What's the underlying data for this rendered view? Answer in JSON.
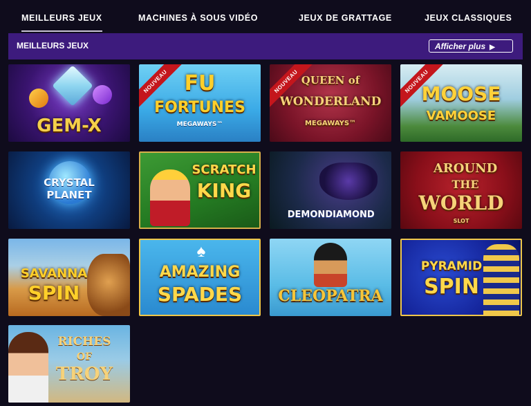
{
  "tabs": [
    {
      "label": "MEILLEURS JEUX",
      "active": true
    },
    {
      "label": "MACHINES À SOUS VIDÉO",
      "active": false
    },
    {
      "label": "JEUX DE GRATTAGE",
      "active": false
    },
    {
      "label": "JEUX CLASSIQUES",
      "active": false
    }
  ],
  "section": {
    "title": "MEILLEURS JEUX",
    "more_label": "Afficher plus",
    "more_icon": "play-arrow-icon"
  },
  "badge_label": "NOUVEAU",
  "games": [
    {
      "line1": "GEM-X",
      "line2": "",
      "line3": "",
      "new": false
    },
    {
      "line1": "FU",
      "line2": "FORTUNES",
      "line3": "MEGAWAYS™",
      "new": true
    },
    {
      "line1": "QUEEN of",
      "line2": "WONDERLAND",
      "line3": "MEGAWAYS™",
      "new": true
    },
    {
      "line1": "MOOSE",
      "line2": "VAMOOSE",
      "line3": "",
      "new": true
    },
    {
      "line1": "CRYSTAL",
      "line2": "PLANET",
      "line3": "",
      "new": false
    },
    {
      "line1": "SCRATCH",
      "line2": "KING",
      "line3": "",
      "new": false
    },
    {
      "line1": "DEMON",
      "line2": "DIAMOND",
      "line3": "",
      "new": false
    },
    {
      "line1": "AROUND",
      "line2": "THE",
      "line3": "WORLD",
      "line4": "SLOT",
      "new": false
    },
    {
      "line1": "SAVANNA",
      "line2": "SPIN",
      "line3": "",
      "new": false
    },
    {
      "line1": "AMAZING",
      "line2": "SPADES",
      "line3": "",
      "new": false
    },
    {
      "line1": "CLEOPATRA",
      "line2": "",
      "line3": "",
      "new": false
    },
    {
      "line1": "PYRAMID",
      "line2": "SPIN",
      "line3": "",
      "new": false
    },
    {
      "line1": "RICHES",
      "line2": "OF",
      "line3": "TROY",
      "new": false
    }
  ],
  "colors": {
    "page_bg": "#0f0c1c",
    "section_bar": "#3d1b7d",
    "new_ribbon": "#c4161c"
  }
}
